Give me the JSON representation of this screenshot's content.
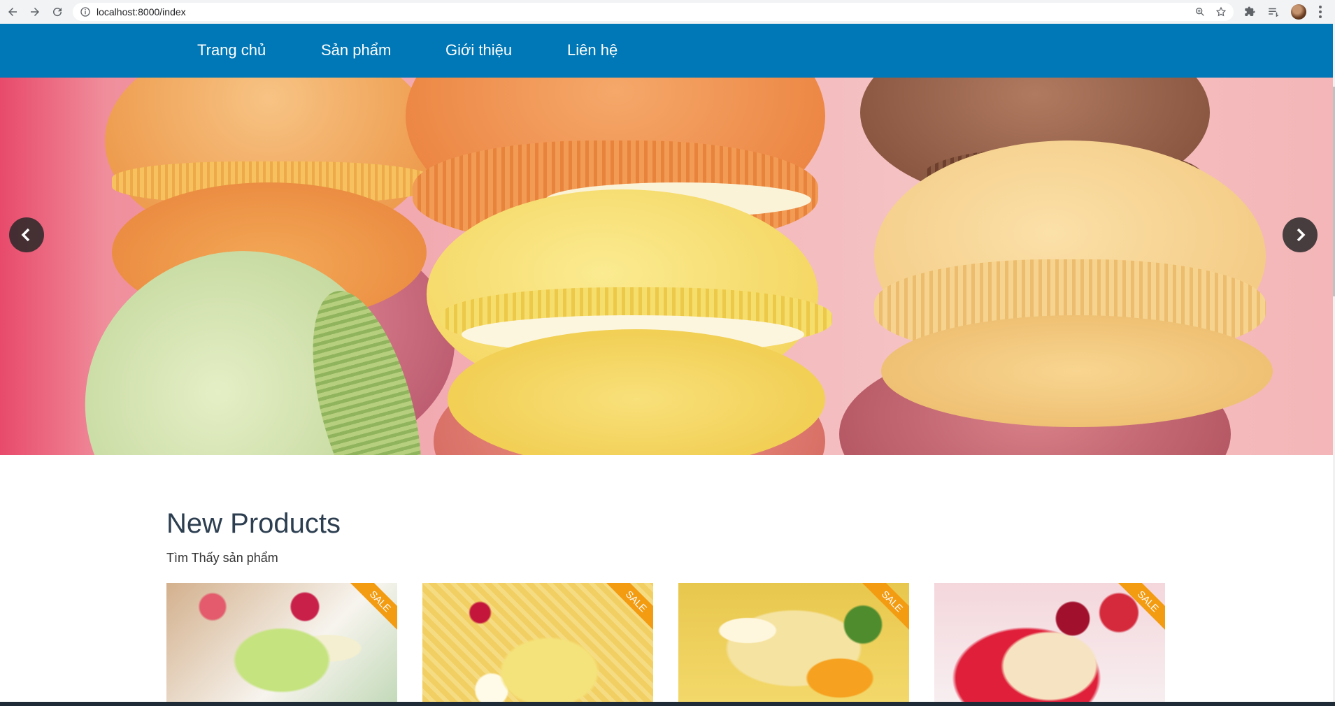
{
  "browser": {
    "url": "localhost:8000/index",
    "icons": [
      "back-icon",
      "forward-icon",
      "reload-icon",
      "info-icon",
      "zoom-icon",
      "star-icon",
      "extensions-icon",
      "reading-list-icon",
      "avatar",
      "menu-icon"
    ]
  },
  "nav": {
    "items": [
      {
        "label": "Trang chủ"
      },
      {
        "label": "Sản phẩm"
      },
      {
        "label": "Giới thiệu"
      },
      {
        "label": "Liên hệ"
      }
    ],
    "bg_color": "#0077b6"
  },
  "slider": {
    "icons": [
      "chevron-left-icon",
      "chevron-right-icon"
    ]
  },
  "products_section": {
    "title": "New Products",
    "subtitle": "Tìm Thấy sản phẩm",
    "items": [
      {
        "badge": "SALE"
      },
      {
        "badge": "SALE"
      },
      {
        "badge": "SALE"
      },
      {
        "badge": "SALE"
      }
    ],
    "badge_color": "#f39c12"
  }
}
